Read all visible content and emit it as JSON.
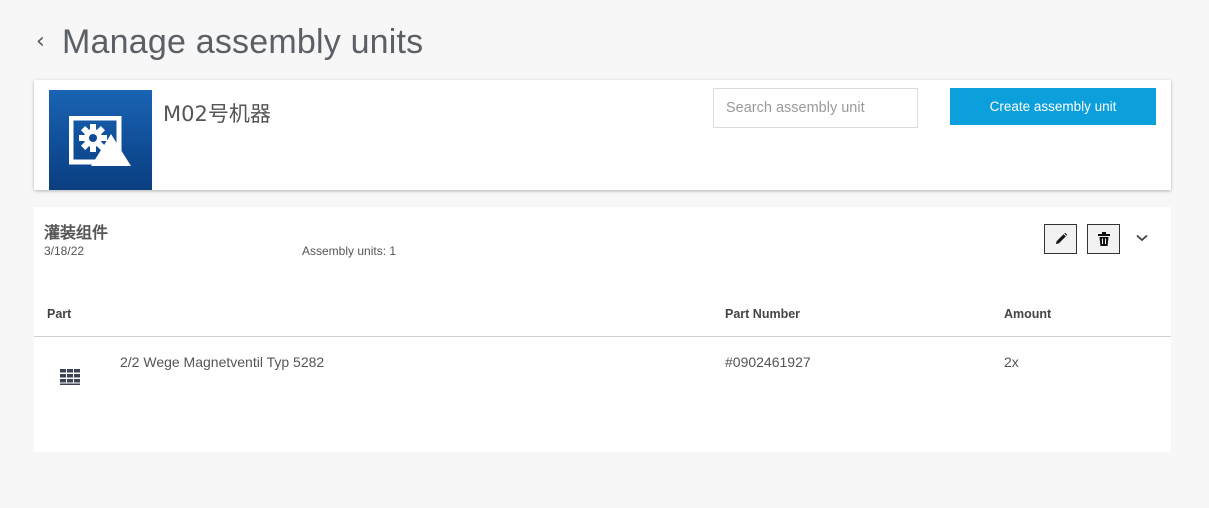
{
  "header": {
    "back_icon": "chevron-left-icon",
    "back_glyph": "‹",
    "title": "Manage assembly units"
  },
  "machine": {
    "name": "M02号机器",
    "thumbnail_icon": "gear-image-icon",
    "search": {
      "placeholder": "Search assembly unit",
      "value": ""
    },
    "create_button_label": "Create assembly unit"
  },
  "assembly_unit": {
    "name": "灌装组件",
    "date": "3/18/22",
    "count_text": "Assembly units: 1",
    "edit_icon": "pencil-icon",
    "delete_icon": "trash-icon",
    "expand_icon": "chevron-down-icon",
    "columns": {
      "part": "Part",
      "part_number": "Part Number",
      "amount": "Amount"
    },
    "parts": [
      {
        "icon": "grid-part-icon",
        "name": "2/2 Wege Magnetventil Typ 5282",
        "part_number": "#0902461927",
        "amount": "2x"
      }
    ]
  },
  "colors": {
    "background": "#f7f7f7",
    "accent": "#0b9fdb",
    "thumbnail": "#0f4c95",
    "title_text": "#5b5f66"
  }
}
